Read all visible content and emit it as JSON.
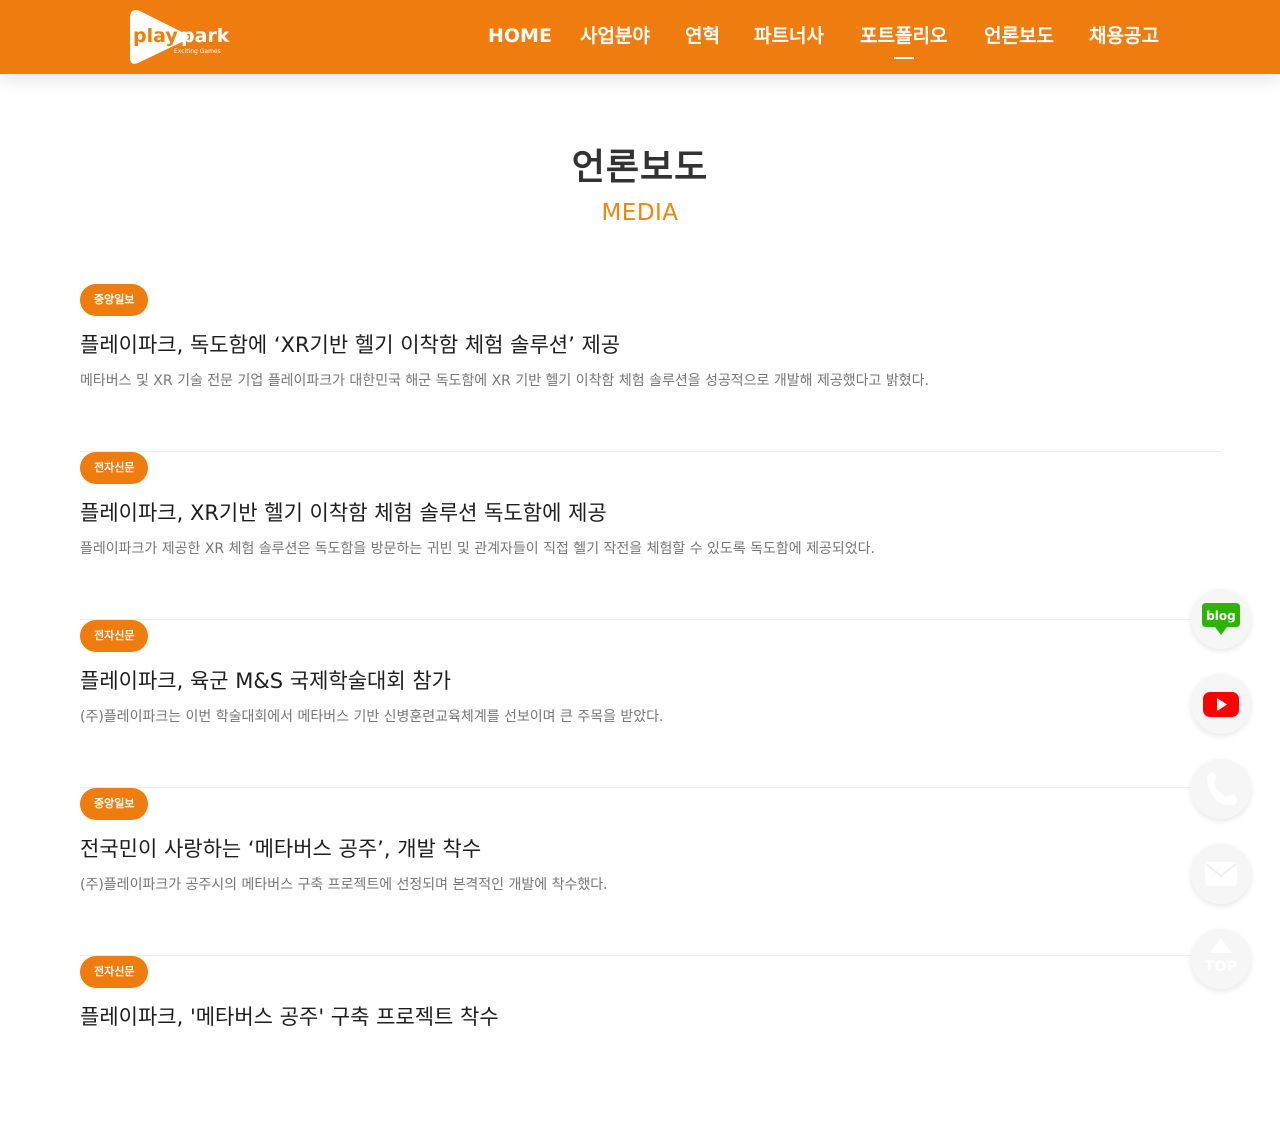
{
  "brand": {
    "logo_word_1": "play",
    "logo_word_2": "park",
    "logo_tagline": "Exciting Games",
    "accent_color": "#ee7c0e"
  },
  "nav": {
    "items": [
      {
        "label": "HOME"
      },
      {
        "label": "사업분야"
      },
      {
        "label": "연혁"
      },
      {
        "label": "파트너사"
      },
      {
        "label": "포트폴리오",
        "active": true
      },
      {
        "label": "언론보도"
      },
      {
        "label": "채용공고"
      }
    ]
  },
  "page": {
    "title": "언론보도",
    "subtitle": "MEDIA"
  },
  "articles": [
    {
      "source": "중앙일보",
      "title": "플레이파크, 독도함에 ‘XR기반 헬기 이착함 체험 솔루션’ 제공",
      "summary": "메타버스 및 XR 기술 전문 기업 플레이파크가 대한민국 해군 독도함에 XR 기반 헬기 이착함 체험 솔루션을 성공적으로 개발해 제공했다고 밝혔다."
    },
    {
      "source": "전자신문",
      "title": "플레이파크, XR기반 헬기 이착함 체험 솔루션 독도함에 제공",
      "summary": "플레이파크가 제공한 XR 체험 솔루션은 독도함을 방문하는 귀빈 및 관계자들이 직접 헬기 작전을 체험할 수 있도록 독도함에 제공되었다."
    },
    {
      "source": "전자신문",
      "title": "플레이파크, 육군 M&S 국제학술대회 참가",
      "summary": "(주)플레이파크는 이번 학술대회에서 메타버스 기반 신병훈련교육체계를 선보이며 큰 주목을 받았다."
    },
    {
      "source": "중앙일보",
      "title": "전국민이 사랑하는 ‘메타버스 공주’, 개발 착수",
      "summary": "(주)플레이파크가 공주시의 메타버스 구축 프로젝트에 선정되며 본격적인 개발에 착수했다."
    },
    {
      "source": "전자신문",
      "title": "플레이파크, '메타버스 공주' 구축 프로젝트 착수",
      "summary": ""
    }
  ],
  "floating": {
    "blog_label": "blog",
    "top_label": "TOP",
    "blog_color": "#2db400",
    "youtube_color": "#ff0000",
    "icons": [
      "blog-icon",
      "youtube-icon",
      "phone-icon",
      "mail-icon",
      "top-arrow-icon"
    ]
  }
}
